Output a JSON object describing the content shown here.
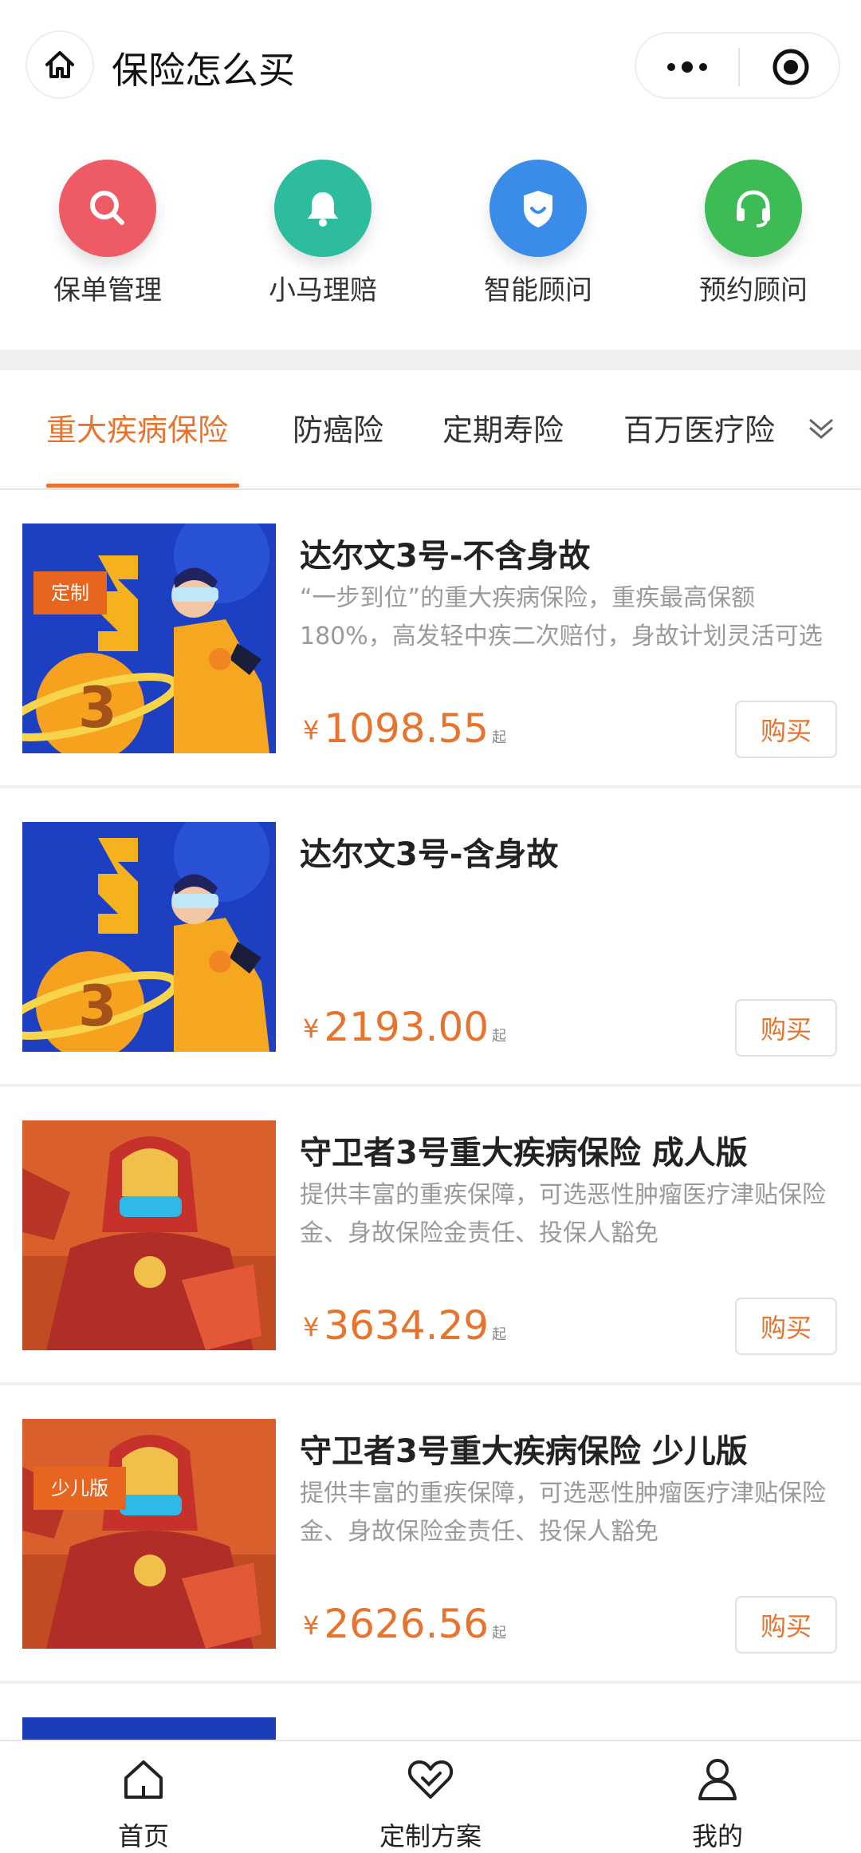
{
  "header": {
    "title": "保险怎么买"
  },
  "quick_actions": [
    {
      "label": "保单管理",
      "icon": "search-icon",
      "color": "#ef5b64"
    },
    {
      "label": "小马理赔",
      "icon": "bell-icon",
      "color": "#2dbd9e"
    },
    {
      "label": "智能顾问",
      "icon": "shield-icon",
      "color": "#3b8ce8"
    },
    {
      "label": "预约顾问",
      "icon": "headset-icon",
      "color": "#3dbb55"
    }
  ],
  "tabs": [
    {
      "label": "重大疾病保险",
      "active": true
    },
    {
      "label": "防癌险",
      "active": false
    },
    {
      "label": "定期寿险",
      "active": false
    },
    {
      "label": "百万医疗险",
      "active": false
    }
  ],
  "products": [
    {
      "tag": "定制",
      "title": "达尔文3号-不含身故",
      "desc": "“一步到位”的重大疾病保险，重疾最高保额180%，高发轻中疾二次赔付，身故计划灵活可选",
      "currency": "¥",
      "price": "1098.55",
      "price_suffix": "起",
      "buy_label": "购买",
      "image": "darwin-3-illustration"
    },
    {
      "tag": "",
      "title": "达尔文3号-含身故",
      "desc": "",
      "currency": "¥",
      "price": "2193.00",
      "price_suffix": "起",
      "buy_label": "购买",
      "image": "darwin-3-illustration"
    },
    {
      "tag": "",
      "title": "守卫者3号重大疾病保险 成人版",
      "desc": "提供丰富的重疾保障，可选恶性肿瘤医疗津贴保险金、身故保险金责任、投保人豁免",
      "currency": "¥",
      "price": "3634.29",
      "price_suffix": "起",
      "buy_label": "购买",
      "image": "guardian-3-illustration"
    },
    {
      "tag": "少儿版",
      "title": "守卫者3号重大疾病保险 少儿版",
      "desc": "提供丰富的重疾保障，可选恶性肿瘤医疗津贴保险金、身故保险金责任、投保人豁免",
      "currency": "¥",
      "price": "2626.56",
      "price_suffix": "起",
      "buy_label": "购买",
      "image": "guardian-3-illustration"
    }
  ],
  "bottom_nav": [
    {
      "label": "首页",
      "icon": "home-icon"
    },
    {
      "label": "定制方案",
      "icon": "heart-icon"
    },
    {
      "label": "我的",
      "icon": "user-icon"
    }
  ],
  "colors": {
    "accent": "#e8732c",
    "tag_bg": "#e8651f",
    "divider": "#efefef"
  }
}
